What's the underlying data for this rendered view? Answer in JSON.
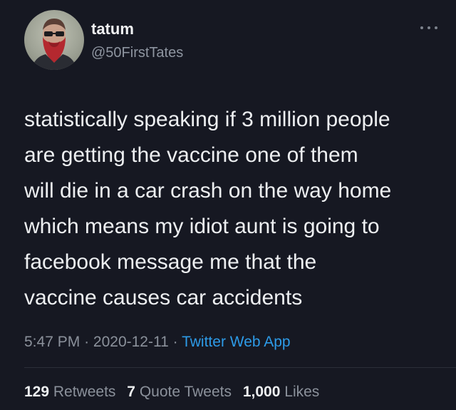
{
  "tweet": {
    "author": {
      "name": "tatum",
      "handle": "@50FirstTates",
      "avatar_icon": "bearded-man-sunglasses-avatar"
    },
    "more_icon": "more-horizontal-icon",
    "text_lines": [
      "statistically speaking if 3 million people",
      "are getting the vaccine one of them",
      "will die in a car crash on the way home",
      "which means my idiot aunt is going to",
      "facebook message me that the",
      "vaccine causes car accidents"
    ],
    "meta": {
      "time": "5:47 PM",
      "separator": "·",
      "date": "2020-12-11",
      "source": "Twitter Web App"
    },
    "stats": {
      "retweets_count": "129",
      "retweets_label": "Retweets",
      "quote_tweets_count": "7",
      "quote_tweets_label": "Quote Tweets",
      "likes_count": "1,000",
      "likes_label": "Likes"
    },
    "colors": {
      "background": "#161822",
      "text": "#edeff1",
      "secondary_text": "#8b919b",
      "link": "#2d9be8"
    }
  }
}
